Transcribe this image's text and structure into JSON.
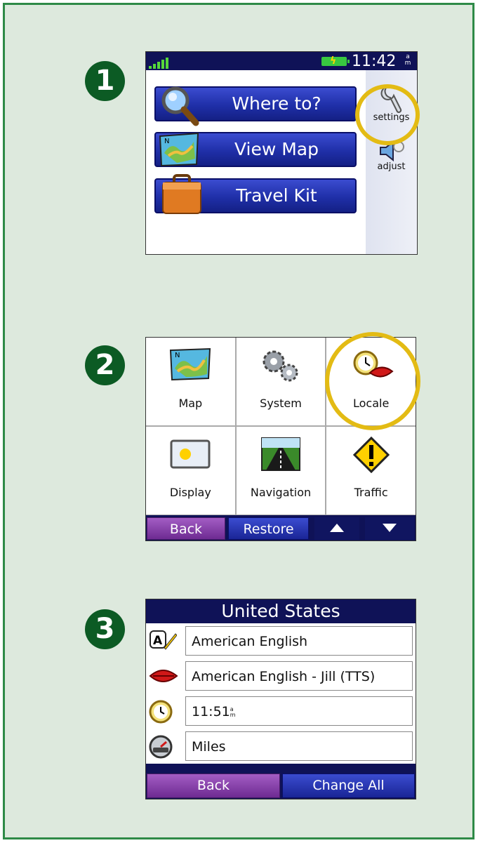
{
  "steps": [
    "1",
    "2",
    "3"
  ],
  "screen1": {
    "status": {
      "time": "11:42",
      "ampm_top": "a",
      "ampm_bottom": "m",
      "signal_icon": "signal-bars-icon",
      "battery_icon": "battery-icon"
    },
    "menu": [
      {
        "label": "Where to?",
        "icon": "magnifier-icon"
      },
      {
        "label": "View Map",
        "icon": "map-icon"
      },
      {
        "label": "Travel Kit",
        "icon": "suitcase-icon"
      }
    ],
    "side": [
      {
        "label": "settings",
        "icon": "wrench-icon"
      },
      {
        "label": "adjust",
        "icon": "speaker-icon"
      }
    ],
    "highlight_color": "#e3bb14"
  },
  "screen2": {
    "tiles": [
      {
        "label": "Map",
        "icon": "map-icon"
      },
      {
        "label": "System",
        "icon": "gears-icon"
      },
      {
        "label": "Locale",
        "icon": "clock-lips-icon"
      },
      {
        "label": "Display",
        "icon": "display-sun-moon-icon"
      },
      {
        "label": "Navigation",
        "icon": "road-icon"
      },
      {
        "label": "Traffic",
        "icon": "warning-icon"
      }
    ],
    "buttons": {
      "back": "Back",
      "restore": "Restore",
      "up_icon": "up-arrow-icon",
      "down_icon": "down-arrow-icon"
    }
  },
  "screen3": {
    "title": "United States",
    "rows": [
      {
        "icon": "text-language-icon",
        "value": "American English"
      },
      {
        "icon": "lips-icon",
        "value": "American English - Jill (TTS)"
      },
      {
        "icon": "clock-icon",
        "value": "11:51",
        "ampm_top": "a",
        "ampm_bottom": "m"
      },
      {
        "icon": "speedometer-icon",
        "value": "Miles"
      }
    ],
    "buttons": {
      "back": "Back",
      "change_all": "Change All"
    }
  },
  "colors": {
    "frame": "#2e8a47",
    "background": "#dde9dd",
    "step_badge": "#0c5b24",
    "title_bar": "#0f1257",
    "button_blue": "#1f2fa8",
    "button_purple": "#7b3aa0"
  }
}
